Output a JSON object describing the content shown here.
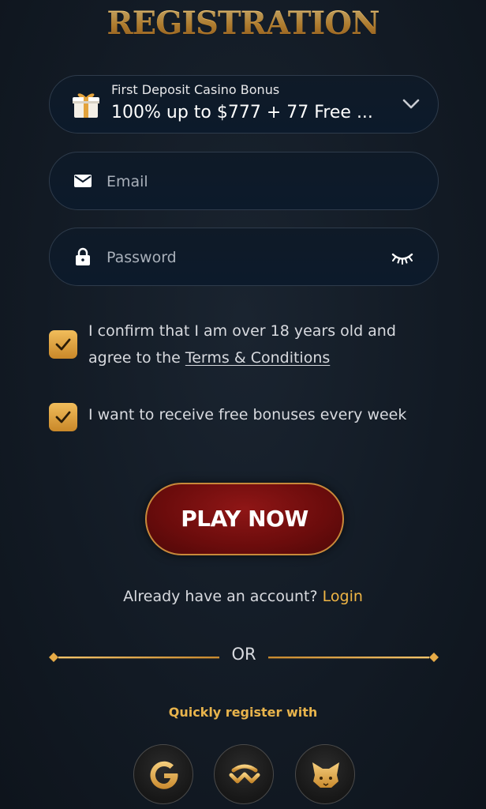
{
  "header": {
    "title": "REGISTRATION"
  },
  "bonus_select": {
    "label": "First Deposit Casino Bonus",
    "value": "100% up to $777 + 77 Free ...",
    "icon": "gift-icon",
    "toggle_icon": "chevron-down-icon"
  },
  "email_field": {
    "placeholder": "Email",
    "value": "",
    "icon": "envelope-icon"
  },
  "password_field": {
    "placeholder": "Password",
    "value": "",
    "icon": "lock-icon",
    "toggle_icon": "eye-closed-icon"
  },
  "consents": {
    "age": {
      "checked": true,
      "line1": "I confirm that I am over 18 years old and",
      "line2_prefix": "agree to the ",
      "terms_link": "Terms & Conditions"
    },
    "bonuses": {
      "checked": true,
      "text": "I want to receive free bonuses every week"
    }
  },
  "cta": {
    "label": "PLAY NOW"
  },
  "account": {
    "prompt": "Already have an account? ",
    "login_link": "Login"
  },
  "divider": {
    "text": "OR"
  },
  "social": {
    "label": "Quickly register with",
    "providers": [
      {
        "name": "Google",
        "icon": "google-icon"
      },
      {
        "name": "WalletConnect",
        "icon": "walletconnect-icon"
      },
      {
        "name": "MetaMask",
        "icon": "metamask-icon"
      }
    ]
  },
  "colors": {
    "background": "#121a24",
    "gold": "#e8b44c",
    "button_red": "#8f1616",
    "field_border": "#2e3b4b"
  }
}
